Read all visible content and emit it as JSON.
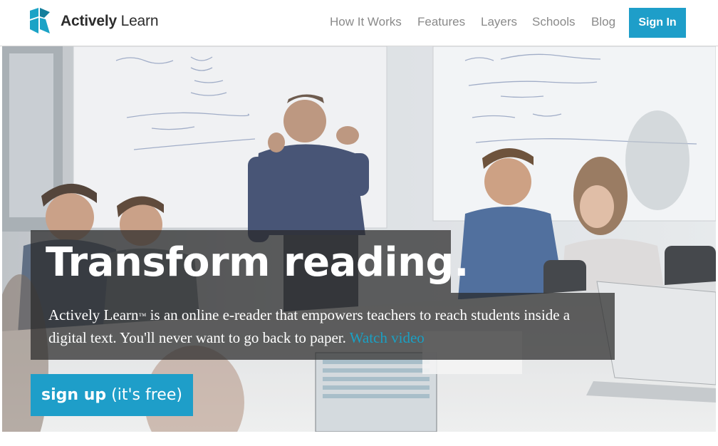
{
  "header": {
    "brand_bold": "Actively",
    "brand_light": " Learn",
    "nav": [
      {
        "label": "How It Works"
      },
      {
        "label": "Features"
      },
      {
        "label": "Layers"
      },
      {
        "label": "Schools"
      },
      {
        "label": "Blog"
      }
    ],
    "signin_label": "Sign In"
  },
  "hero": {
    "headline": "Transform reading.",
    "description_brand": "Actively Learn",
    "description_tm": "™",
    "description_text": " is an online e-reader that empowers teachers to reach students inside a digital text.  You'll never want to go back to paper. ",
    "watch_video": "Watch video",
    "signup_bold": "sign up",
    "signup_rest": " (it's free)"
  },
  "colors": {
    "accent": "#1e9ec9",
    "link": "#1aa0c4",
    "logo_teal": "#1ba3c6",
    "overlay": "#282828"
  }
}
